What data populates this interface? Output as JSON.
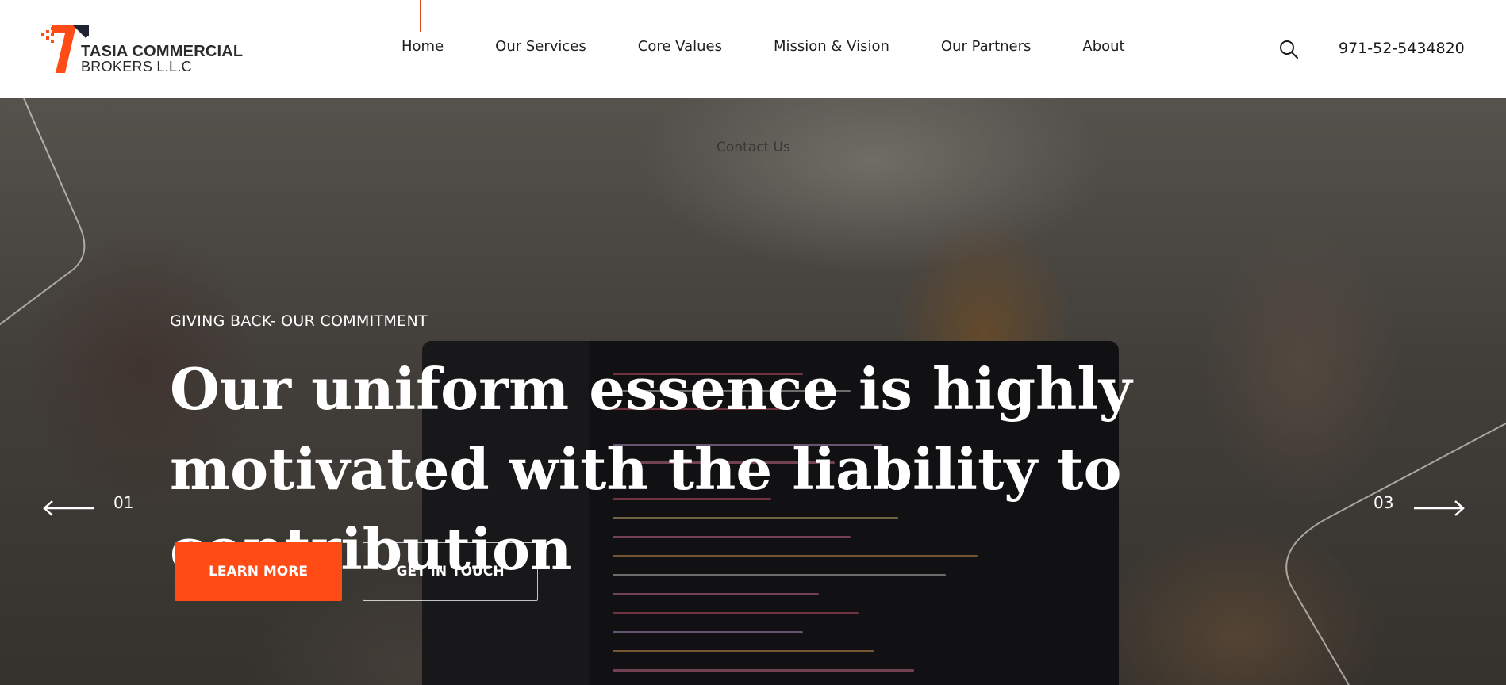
{
  "brand": {
    "name_line1": "TASIA COMMERCIAL",
    "name_line2": "BROKERS L.L.C",
    "accent_color": "#ff4b15"
  },
  "nav": {
    "items": [
      {
        "label": "Home",
        "active": true
      },
      {
        "label": "Our Services"
      },
      {
        "label": "Core Values"
      },
      {
        "label": "Mission & Vision"
      },
      {
        "label": "Our Partners"
      },
      {
        "label": "About"
      }
    ],
    "contact_label": "Contact Us",
    "search_icon": "search-icon",
    "phone": "971-52-5434820"
  },
  "hero": {
    "eyebrow": "GIVING BACK- OUR COMMITMENT",
    "headline": "Our uniform essence is highly motivated with the liability to contribution",
    "primary_button": "LEARN MORE",
    "secondary_button": "GET IN TOUCH",
    "slider": {
      "prev_number": "01",
      "next_number": "03",
      "prev_icon": "arrow-left-icon",
      "next_icon": "arrow-right-icon"
    }
  }
}
